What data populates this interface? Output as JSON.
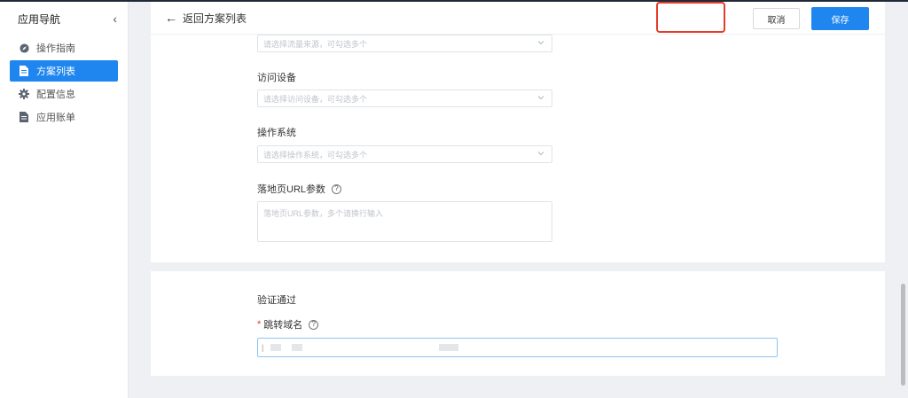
{
  "sidebar": {
    "title": "应用导航",
    "collapse_icon": "‹",
    "items": [
      {
        "label": "操作指南",
        "icon": "compass-icon",
        "active": false
      },
      {
        "label": "方案列表",
        "icon": "document-icon",
        "active": true
      },
      {
        "label": "配置信息",
        "icon": "gear-icon",
        "active": false
      },
      {
        "label": "应用账单",
        "icon": "bill-icon",
        "active": false
      }
    ]
  },
  "header": {
    "back_label": "返回方案列表",
    "cancel_label": "取消",
    "save_label": "保存"
  },
  "form": {
    "traffic_source": {
      "placeholder": "请选择流量来源，可勾选多个"
    },
    "device": {
      "label": "访问设备",
      "placeholder": "请选择访问设备，可勾选多个"
    },
    "os": {
      "label": "操作系统",
      "placeholder": "请选择操作系统，可勾选多个"
    },
    "landing_params": {
      "label": "落地页URL参数",
      "placeholder": "落地页URL参数，多个请换行输入"
    }
  },
  "verify": {
    "status": "验证通过",
    "domain_label": "跳转域名",
    "required_mark": "*"
  },
  "colors": {
    "primary": "#1f86f0",
    "highlight": "#e33c2a"
  }
}
